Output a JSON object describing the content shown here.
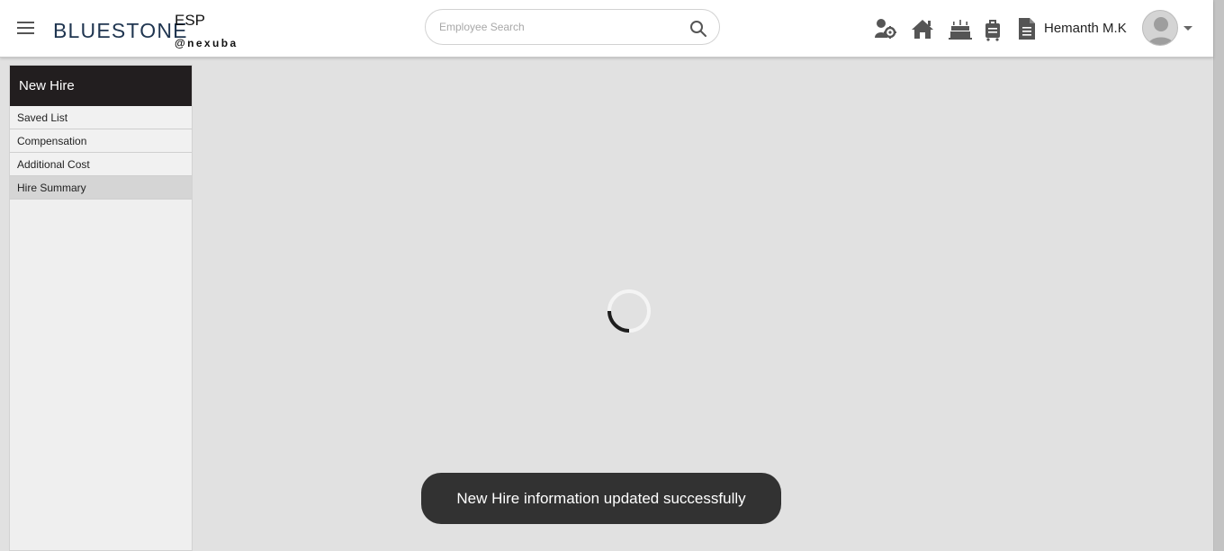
{
  "header": {
    "brand": "BLUESTONE",
    "product": "ESP",
    "tagline": "@nexuba",
    "search_placeholder": "Employee Search",
    "user_name": "Hemanth M.K",
    "icons": [
      "team-settings-icon",
      "home-icon",
      "birthday-cake-icon",
      "luggage-icon",
      "document-icon"
    ]
  },
  "sidebar": {
    "title": "New Hire",
    "items": [
      {
        "label": "Saved List",
        "active": false
      },
      {
        "label": "Compensation",
        "active": false
      },
      {
        "label": "Additional Cost",
        "active": false
      },
      {
        "label": "Hire Summary",
        "active": true
      }
    ]
  },
  "toast": {
    "message": "New Hire information updated successfully"
  },
  "colors": {
    "sidebar_header": "#221e1f",
    "brand": "#1f3550",
    "toast_bg": "#323232",
    "background": "#e1e1e1"
  }
}
